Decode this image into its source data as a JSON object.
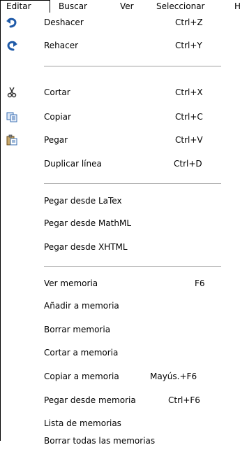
{
  "menubar": {
    "items": [
      {
        "label": "Editar"
      },
      {
        "label": "Buscar"
      },
      {
        "label": "Ver"
      },
      {
        "label": "Seleccionar"
      },
      {
        "label": "H"
      }
    ]
  },
  "menu": {
    "items": [
      {
        "label": "Deshacer",
        "shortcut": "Ctrl+Z",
        "icon": "undo-icon"
      },
      {
        "label": "Rehacer",
        "shortcut": "Ctrl+Y",
        "icon": "redo-icon"
      },
      {
        "label": "Cortar",
        "shortcut": "Ctrl+X",
        "icon": "scissors-icon"
      },
      {
        "label": "Copiar",
        "shortcut": "Ctrl+C",
        "icon": "copy-icon"
      },
      {
        "label": "Pegar",
        "shortcut": "Ctrl+V",
        "icon": "paste-icon"
      },
      {
        "label": "Duplicar línea",
        "shortcut": "Ctrl+D"
      },
      {
        "label": "Pegar desde LaTex"
      },
      {
        "label": "Pegar desde MathML"
      },
      {
        "label": "Pegar desde XHTML"
      },
      {
        "label": "Ver memoria",
        "shortcut": "F6"
      },
      {
        "label": "Añadir a memoria"
      },
      {
        "label": "Borrar memoria"
      },
      {
        "label": "Cortar a memoria"
      },
      {
        "label": "Copiar a memoria",
        "shortcut": "Mayús.+F6"
      },
      {
        "label": "Pegar desde memoria",
        "shortcut": "Ctrl+F6"
      },
      {
        "label": "Lista de memorias"
      },
      {
        "label": "Borrar todas las memorias"
      }
    ]
  },
  "colors": {
    "undo_redo_blue": "#1f5aa8",
    "separator": "#a0a0a0"
  }
}
